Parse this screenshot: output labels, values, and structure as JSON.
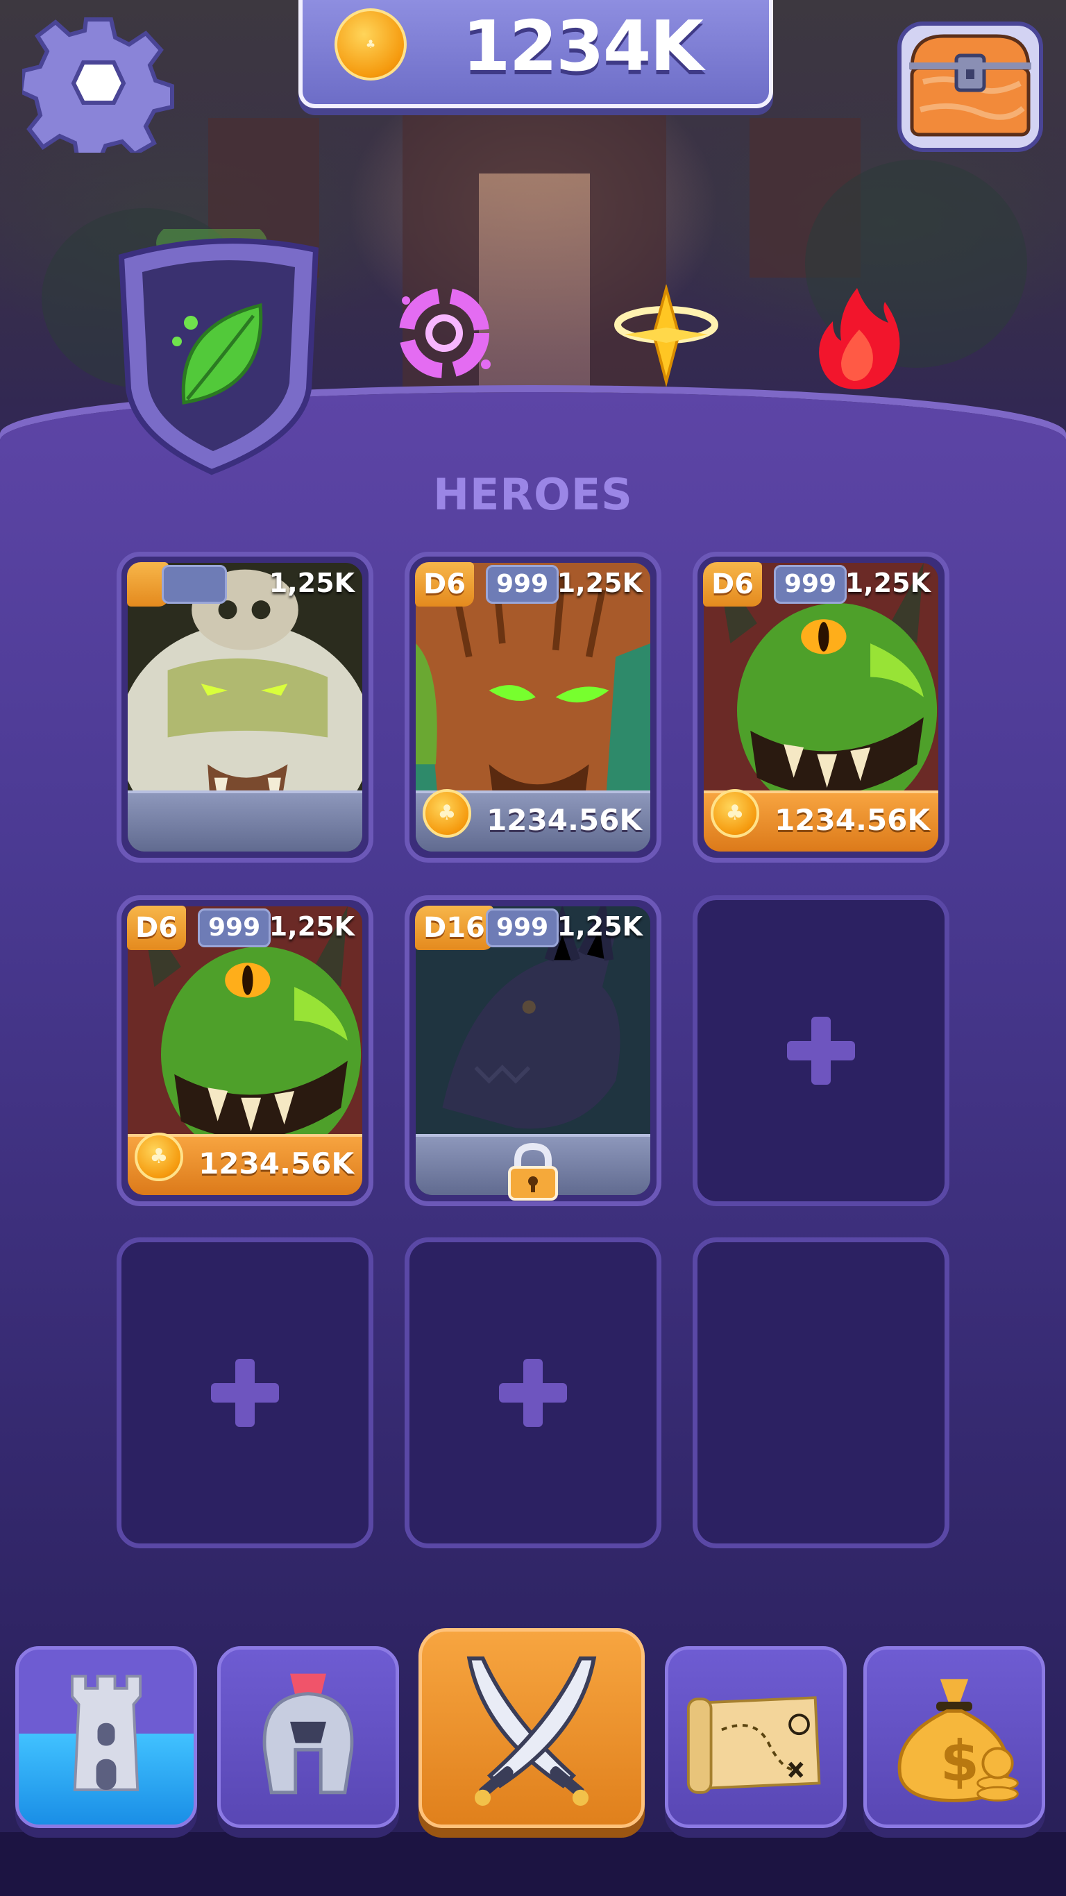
{
  "hud": {
    "coin_amount": "1234K"
  },
  "elements": [
    {
      "name": "nature",
      "icon": "leaf-icon",
      "selected": true,
      "color": "#4fcf3a"
    },
    {
      "name": "arcane",
      "icon": "swirl-icon",
      "selected": false,
      "color": "#e36cf0"
    },
    {
      "name": "light",
      "icon": "halo-star-icon",
      "selected": false,
      "color": "#ffcc33"
    },
    {
      "name": "fire",
      "icon": "flame-icon",
      "selected": false,
      "color": "#ff2a3a"
    }
  ],
  "section_title": "HEROES",
  "heroes": [
    {
      "d": "",
      "level": "",
      "power": "1,25K",
      "price": "",
      "price_style": "locked-empty",
      "portrait": "white-wolf-skull"
    },
    {
      "d": "D6",
      "level": "999",
      "power": "1,25K",
      "price": "1234.56K",
      "price_style": "gray",
      "portrait": "tree-ent"
    },
    {
      "d": "D6",
      "level": "999",
      "power": "1,25K",
      "price": "1234.56K",
      "price_style": "gold",
      "portrait": "green-goblin"
    },
    {
      "d": "D6",
      "level": "999",
      "power": "1,25K",
      "price": "1234.56K",
      "price_style": "gold",
      "portrait": "green-goblin"
    },
    {
      "d": "D16",
      "level": "999",
      "power": "1,25K",
      "price": "",
      "price_style": "locked",
      "portrait": "shadow-dragon"
    }
  ],
  "empty_slots": 4,
  "nav": [
    {
      "name": "castle",
      "icon": "castle-tower-icon",
      "active": false
    },
    {
      "name": "heroes",
      "icon": "spartan-helmet-icon",
      "active": false
    },
    {
      "name": "battle",
      "icon": "crossed-swords-icon",
      "active": true
    },
    {
      "name": "map",
      "icon": "treasure-map-icon",
      "active": false
    },
    {
      "name": "shop",
      "icon": "money-bag-icon",
      "active": false
    }
  ],
  "colors": {
    "panel": "#4b3a93",
    "accent_orange": "#e48a1e",
    "title": "#9b86e6"
  }
}
